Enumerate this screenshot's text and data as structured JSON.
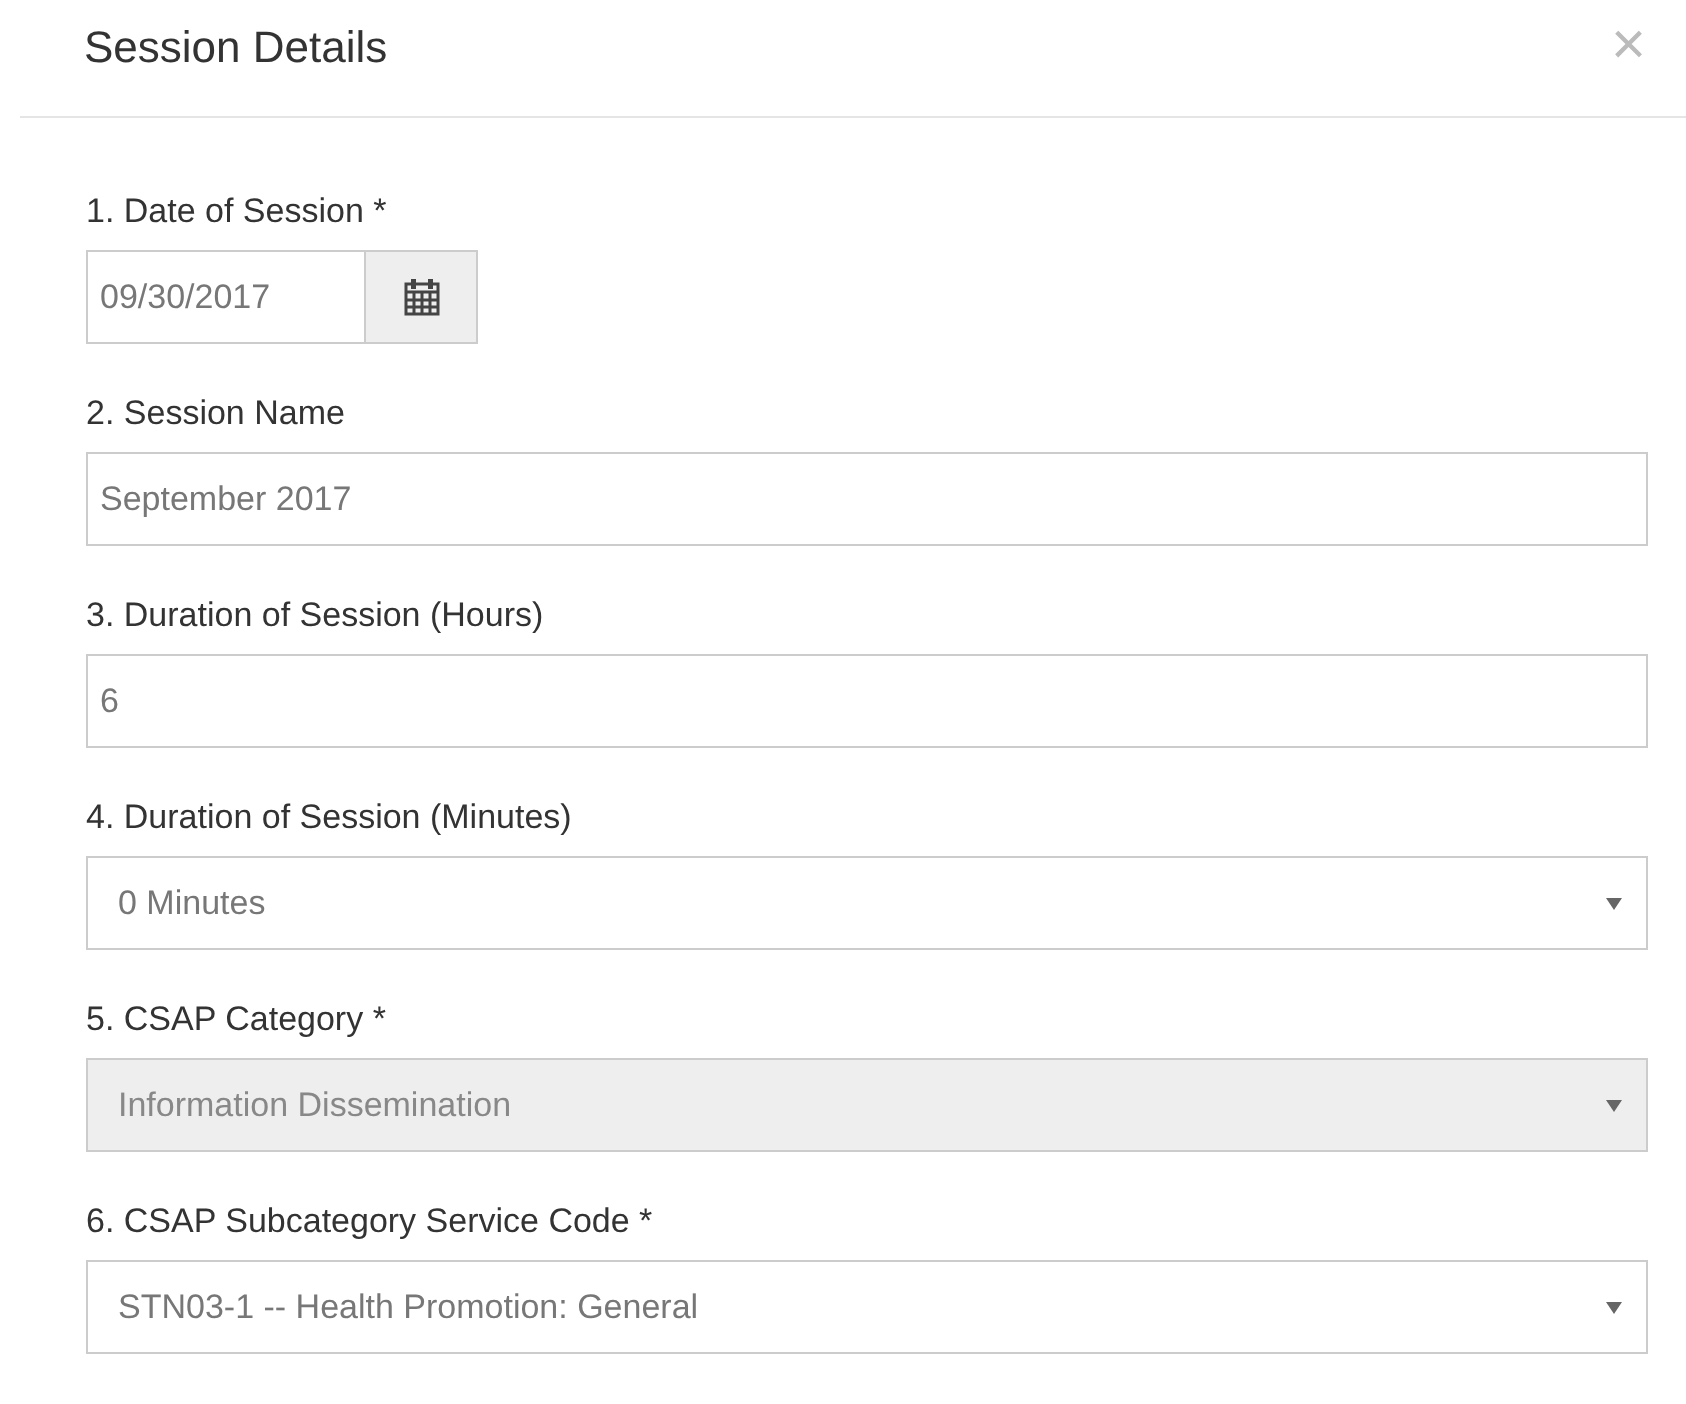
{
  "dialog": {
    "title": "Session Details",
    "close": "×"
  },
  "fields": [
    {
      "kind": "date",
      "label": "1. Date of Session *",
      "value": "09/30/2017",
      "disabled": false
    },
    {
      "kind": "text",
      "label": "2. Session Name",
      "value": "September 2017",
      "disabled": false
    },
    {
      "kind": "text",
      "label": "3. Duration of Session (Hours)",
      "value": "6",
      "disabled": false
    },
    {
      "kind": "select",
      "label": "4. Duration of Session (Minutes)",
      "value": "0 Minutes",
      "disabled": false
    },
    {
      "kind": "select",
      "label": "5. CSAP Category *",
      "value": "Information Dissemination",
      "disabled": true
    },
    {
      "kind": "select",
      "label": "6. CSAP Subcategory Service Code *",
      "value": "STN03-1 -- Health Promotion: General",
      "disabled": false
    }
  ]
}
